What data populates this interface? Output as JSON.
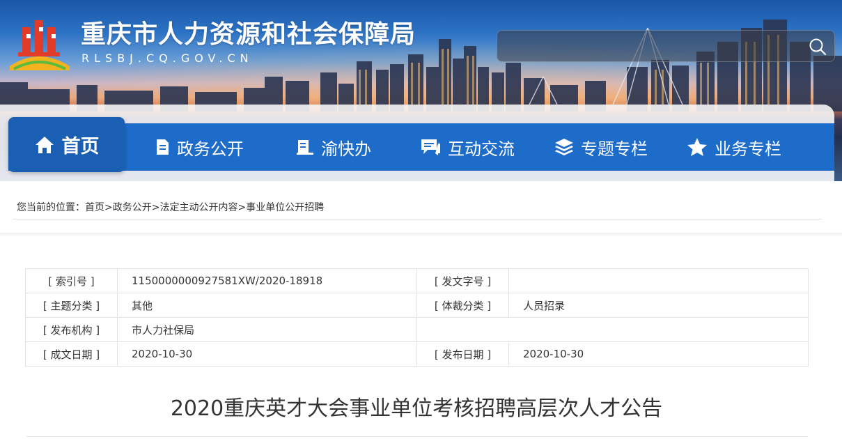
{
  "header": {
    "site_title": "重庆市人力资源和社会保障局",
    "site_domain": "RLSBJ.CQ.GOV.CN",
    "search": {
      "value": "",
      "placeholder": ""
    }
  },
  "nav": {
    "items": [
      {
        "label": "首页",
        "icon": "home-icon",
        "active": true
      },
      {
        "label": "政务公开",
        "icon": "document-icon"
      },
      {
        "label": "渝快办",
        "icon": "book-icon"
      },
      {
        "label": "互动交流",
        "icon": "chat-icon"
      },
      {
        "label": "专题专栏",
        "icon": "layers-icon"
      },
      {
        "label": "业务专栏",
        "icon": "star-icon"
      }
    ]
  },
  "breadcrumb": {
    "prefix": "您当前的位置：",
    "items": [
      "首页",
      "政务公开",
      "法定主动公开内容",
      "事业单位公开招聘"
    ],
    "separator": ">"
  },
  "meta": {
    "index_label": "[ 索引号 ]",
    "index_value": "1150000000927581XW/2020-18918",
    "doc_no_label": "[ 发文字号 ]",
    "doc_no_value": "",
    "topic_label": "[ 主题分类 ]",
    "topic_value": "其他",
    "genre_label": "[ 体裁分类 ]",
    "genre_value": "人员招录",
    "publisher_label": "[ 发布机构 ]",
    "publisher_value": "市人力社保局",
    "created_label": "[ 成文日期 ]",
    "created_value": "2020-10-30",
    "published_label": "[ 发布日期 ]",
    "published_value": "2020-10-30"
  },
  "article": {
    "title": "2020重庆英才大会事业单位考核招聘高层次人才公告"
  },
  "colors": {
    "nav_blue": "#1d6cc9",
    "nav_active": "#1a5fb4",
    "text": "#333333",
    "border": "#e2e2e2"
  }
}
